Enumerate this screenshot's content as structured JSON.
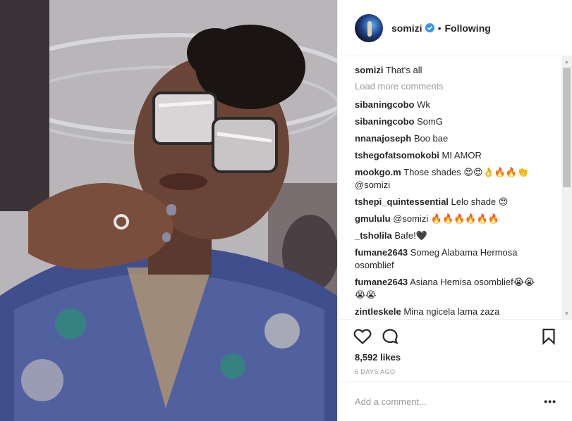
{
  "post": {
    "username": "somizi",
    "follow_status": "Following",
    "separator": "•",
    "verified": true
  },
  "comments": {
    "caption": {
      "user": "somizi",
      "text": "That's all"
    },
    "load_more_label": "Load more comments",
    "items": [
      {
        "user": "sibaningcobo",
        "text": "Wk"
      },
      {
        "user": "sibaningcobo",
        "text": "SomG"
      },
      {
        "user": "nnanajoseph",
        "text": "Boo bae"
      },
      {
        "user": "tshegofatsomokobi",
        "text": "MI AMOR"
      },
      {
        "user": "mookgo.m",
        "text": "Those shades 😍😍👌🔥🔥👏 @somizi"
      },
      {
        "user": "tshepi_quintessential",
        "text": "Lelo shade 😍"
      },
      {
        "user": "gmululu",
        "text": "@somizi 🔥🔥🔥🔥🔥🔥"
      },
      {
        "user": "_tsholila",
        "text": "Bafe!🖤"
      },
      {
        "user": "fumane2643",
        "text": "Someg Alabama Hermosa osomblief"
      },
      {
        "user": "fumane2643",
        "text": "Asiana Hemisa osomblief😭😭😭😭"
      },
      {
        "user": "zintleskele",
        "text": "Mina ngicela lama zaza"
      }
    ]
  },
  "actions": {
    "like_icon": "heart-outline-icon",
    "comment_icon": "speech-bubble-icon",
    "save_icon": "bookmark-icon"
  },
  "likes_text": "8,592 likes",
  "timestamp": "6 DAYS AGO",
  "add_comment": {
    "placeholder": "Add a comment...",
    "more_label": "•••"
  },
  "colors": {
    "verified": "#3897f0",
    "muted": "#999999",
    "text": "#262626"
  }
}
